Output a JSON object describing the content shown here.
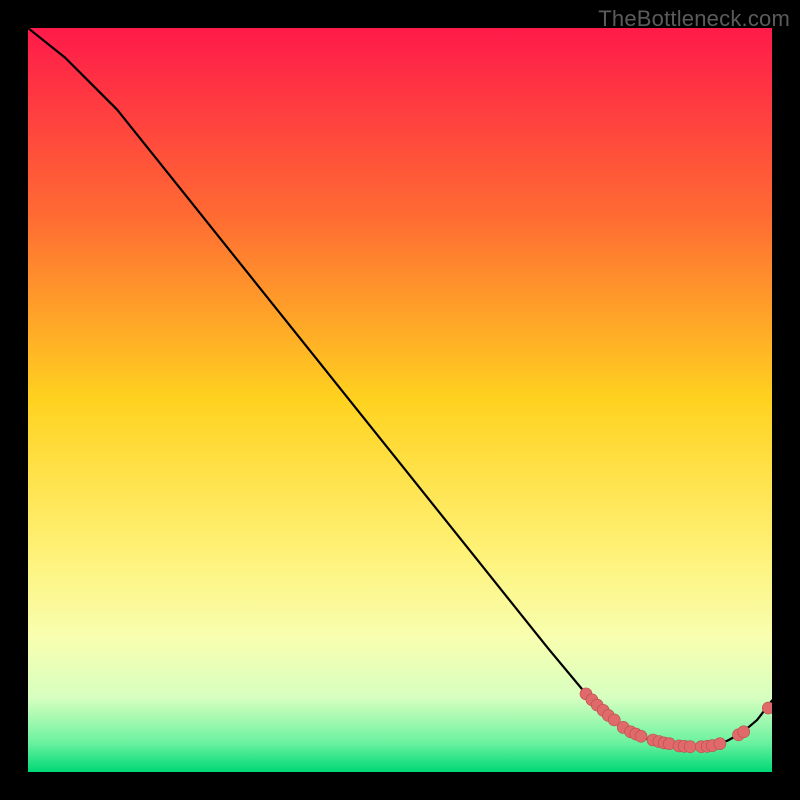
{
  "watermark": "TheBottleneck.com",
  "chart_data": {
    "type": "line",
    "title": "",
    "xlabel": "",
    "ylabel": "",
    "xlim": [
      0,
      100
    ],
    "ylim": [
      0,
      100
    ],
    "grid": false,
    "legend": false,
    "background_gradient_stops": [
      {
        "offset": 0,
        "color": "#ff1a4a"
      },
      {
        "offset": 25,
        "color": "#ff6a33"
      },
      {
        "offset": 50,
        "color": "#ffd21f"
      },
      {
        "offset": 70,
        "color": "#fff175"
      },
      {
        "offset": 82,
        "color": "#f8ffb0"
      },
      {
        "offset": 90,
        "color": "#d7ffc0"
      },
      {
        "offset": 96,
        "color": "#6cf2a0"
      },
      {
        "offset": 100,
        "color": "#00d876"
      }
    ],
    "series": [
      {
        "name": "curve",
        "color": "#000000",
        "x": [
          0,
          5,
          8,
          12,
          20,
          30,
          40,
          50,
          60,
          70,
          75,
          78,
          80,
          83,
          86,
          88,
          90,
          92,
          94,
          96,
          98,
          100
        ],
        "y": [
          100,
          96,
          93,
          89,
          79,
          66.5,
          54,
          41.5,
          29,
          16.5,
          10.5,
          7.5,
          6.0,
          4.5,
          3.7,
          3.4,
          3.4,
          3.6,
          4.2,
          5.3,
          7.0,
          9.6
        ]
      }
    ],
    "points": {
      "name": "dots",
      "color": "#e06a6a",
      "radius": 6,
      "x": [
        75.0,
        75.8,
        76.5,
        77.3,
        78.0,
        78.8,
        80.0,
        81.0,
        81.7,
        82.4,
        84.0,
        84.8,
        85.5,
        86.2,
        87.5,
        88.2,
        89.0,
        90.5,
        91.3,
        92.0,
        93.0,
        95.5,
        96.2,
        99.5
      ],
      "y": [
        10.5,
        9.7,
        9.0,
        8.3,
        7.6,
        7.0,
        6.0,
        5.4,
        5.1,
        4.8,
        4.3,
        4.1,
        3.9,
        3.8,
        3.5,
        3.45,
        3.4,
        3.4,
        3.45,
        3.55,
        3.8,
        5.0,
        5.4,
        8.6
      ]
    }
  }
}
